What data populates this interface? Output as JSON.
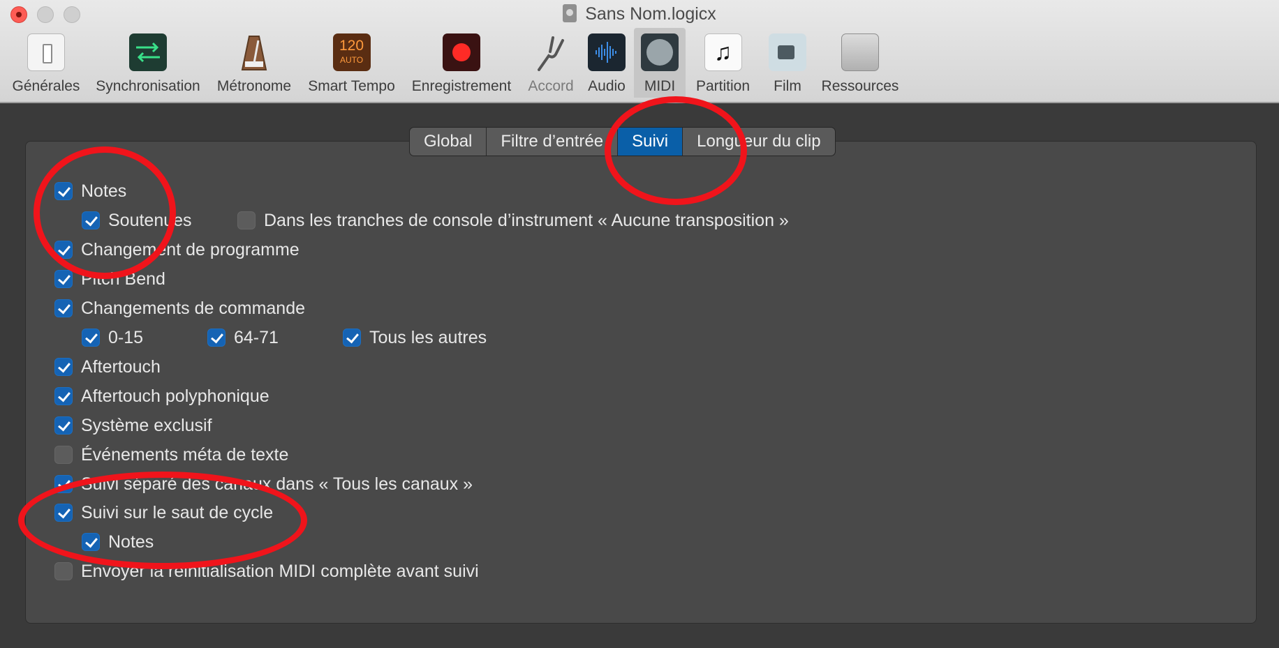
{
  "window": {
    "title": "Sans Nom.logicx",
    "doc_icon": "document-icon"
  },
  "toolbar": {
    "items": [
      {
        "label": "Générales",
        "icon": "general-switch-icon"
      },
      {
        "label": "Synchronisation",
        "icon": "sync-arrows-icon"
      },
      {
        "label": "Métronome",
        "icon": "metronome-icon"
      },
      {
        "label": "Smart Tempo",
        "icon": "tempo-icon",
        "icon_text_top": "120",
        "icon_text_bottom": "AUTO"
      },
      {
        "label": "Enregistrement",
        "icon": "record-icon"
      },
      {
        "label": "Accord",
        "icon": "tuning-fork-icon"
      },
      {
        "label": "Audio",
        "icon": "waveform-icon"
      },
      {
        "label": "MIDI",
        "icon": "midi-connector-icon",
        "selected": true
      },
      {
        "label": "Partition",
        "icon": "music-note-icon"
      },
      {
        "label": "Film",
        "icon": "video-camera-icon"
      },
      {
        "label": "Ressources",
        "icon": "briefcase-icon"
      }
    ]
  },
  "tabs": [
    {
      "label": "Global"
    },
    {
      "label": "Filtre d’entrée"
    },
    {
      "label": "Suivi",
      "selected": true
    },
    {
      "label": "Longueur du clip"
    }
  ],
  "options": {
    "notes": {
      "label": "Notes",
      "checked": true
    },
    "soutenues": {
      "label": "Soutenues",
      "checked": true
    },
    "no_transpose": {
      "label": "Dans les tranches de console d’instrument « Aucune transposition »",
      "checked": false
    },
    "program_change": {
      "label": "Changement de programme",
      "checked": true
    },
    "pitch_bend": {
      "label": "Pitch Bend",
      "checked": true
    },
    "control_change": {
      "label": "Changements de commande",
      "checked": true
    },
    "cc_0_15": {
      "label": "0-15",
      "checked": true
    },
    "cc_64_71": {
      "label": "64-71",
      "checked": true
    },
    "cc_others": {
      "label": "Tous les autres",
      "checked": true
    },
    "aftertouch": {
      "label": "Aftertouch",
      "checked": true
    },
    "poly_aftertouch": {
      "label": "Aftertouch polyphonique",
      "checked": true
    },
    "sysex": {
      "label": "Système exclusif",
      "checked": true
    },
    "meta_text": {
      "label": "Événements méta de texte",
      "checked": false
    },
    "separate_channels": {
      "label": "Suivi séparé des canaux dans « Tous les canaux »",
      "checked": true
    },
    "cycle_jump": {
      "label": "Suivi sur le saut de cycle",
      "checked": true
    },
    "cycle_notes": {
      "label": "Notes",
      "checked": true
    },
    "midi_reset": {
      "label": "Envoyer la réinitialisation MIDI complète avant suivi",
      "checked": false
    }
  },
  "colors": {
    "accent": "#1563b4",
    "annotation": "#f0141b"
  }
}
